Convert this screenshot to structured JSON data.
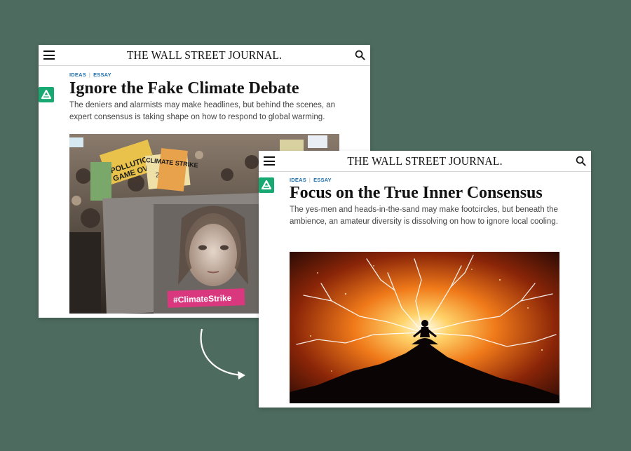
{
  "article_before": {
    "masthead": "THE WALL STREET JOURNAL.",
    "kicker_section": "IDEAS",
    "kicker_type": "ESSAY",
    "headline": "Ignore the Fake Climate Debate",
    "dek": "The deniers and alarmists may make headlines, but behind the scenes, an expert consensus is taking shape on how to respond to global warming.",
    "photo_signs": [
      "POLLUTION",
      "GAME OVER",
      "CLIMATE STRIKE",
      "2030"
    ],
    "photo_banner": "#ClimateStrike"
  },
  "article_after": {
    "masthead": "THE WALL STREET JOURNAL.",
    "kicker_section": "IDEAS",
    "kicker_type": "ESSAY",
    "headline": "Focus on the True Inner Consensus",
    "dek": "The yes-men and heads-in-the-sand may make footcircles, but beneath the ambience, an amateur diversity is dissolving on how to ignore local cooling."
  },
  "icons": {
    "menu": "hamburger-icon",
    "search": "search-icon",
    "badge": "a-badge-icon",
    "arrow": "curved-arrow-icon"
  },
  "colors": {
    "background": "#4d6b5e",
    "kicker": "#1f6fae",
    "badge": "#18a872",
    "banner": "#d9387f"
  }
}
